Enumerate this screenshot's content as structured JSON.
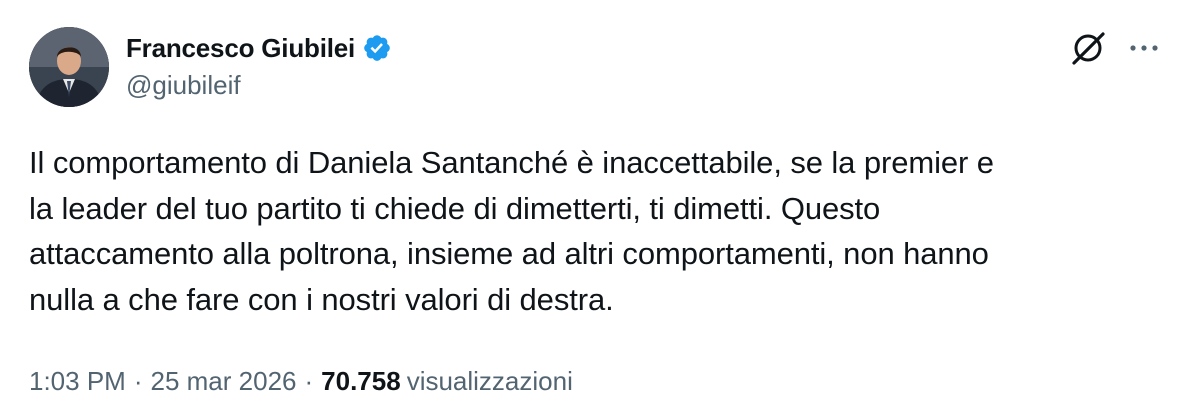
{
  "author": {
    "display_name": "Francesco Giubilei",
    "handle": "@giubileif",
    "verified_icon": "verified-badge-icon",
    "verified_color": "#1d9bf0"
  },
  "actions": {
    "grok_icon": "grok-icon",
    "more_icon": "more-options-icon"
  },
  "tweet": {
    "lines": [
      "Il comportamento di Daniela Santanché è inaccettabile, se la premier e",
      "la leader del tuo partito ti chiede di dimetterti, ti dimetti. Questo",
      "attaccamento alla poltrona, insieme ad altri comportamenti, non hanno",
      "nulla a che fare con i nostri valori di destra."
    ]
  },
  "meta": {
    "time": "1:03 PM",
    "separator": "·",
    "date": "25 mar 2026",
    "views_count": "70.758",
    "views_label": "visualizzazioni"
  },
  "colors": {
    "text_primary": "#0f1419",
    "text_secondary": "#536471",
    "accent": "#1d9bf0"
  }
}
